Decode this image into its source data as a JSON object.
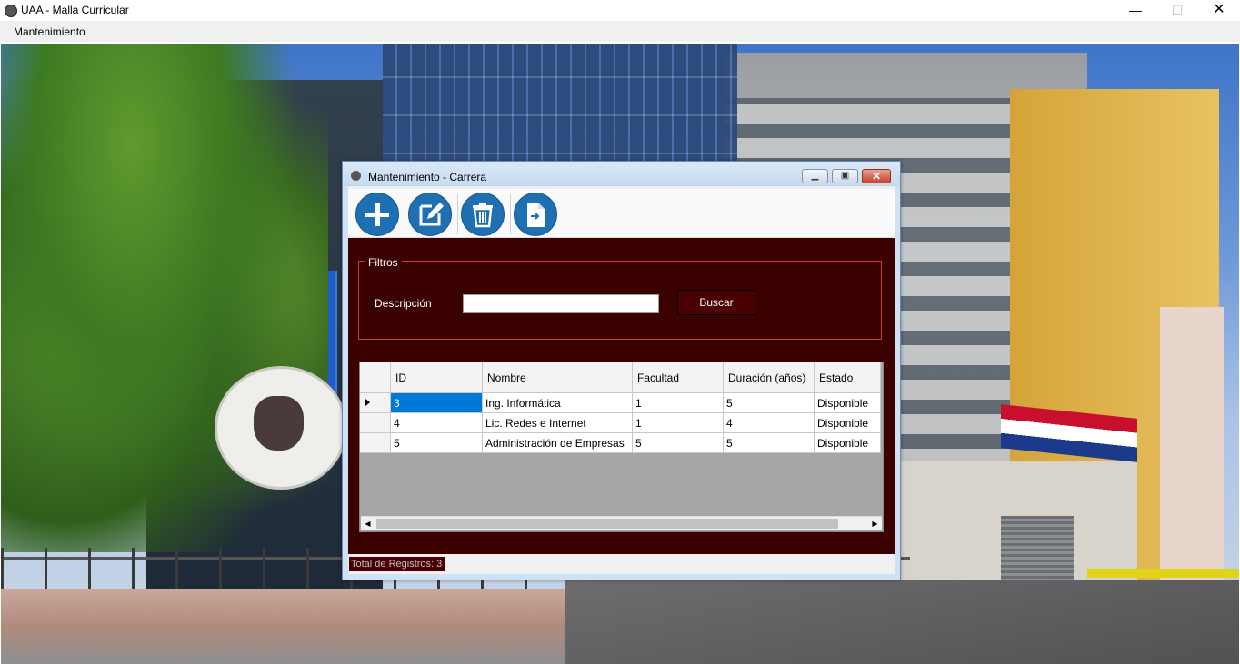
{
  "window": {
    "title": "UAA - Malla Curricular",
    "controls": {
      "minimize": "—",
      "maximize": "☐",
      "close": "✕"
    }
  },
  "menu": {
    "items": [
      {
        "label": "Mantenimiento"
      }
    ]
  },
  "dialog": {
    "title": "Mantenimiento - Carrera",
    "controls": {
      "minimize": "▁",
      "maximize": "▣",
      "close": "✕"
    },
    "toolbar": {
      "buttons": [
        {
          "name": "add",
          "icon": "plus-circle-icon"
        },
        {
          "name": "edit",
          "icon": "edit-icon"
        },
        {
          "name": "delete",
          "icon": "trash-icon"
        },
        {
          "name": "export",
          "icon": "export-file-icon"
        }
      ]
    },
    "filters": {
      "legend": "Filtros",
      "description_label": "Descripción",
      "description_value": "",
      "search_button": "Buscar"
    },
    "grid": {
      "columns": [
        "ID",
        "Nombre",
        "Facultad",
        "Duración (años)",
        "Estado"
      ],
      "rows": [
        {
          "id": "3",
          "nombre": "Ing. Informática",
          "facultad": "1",
          "duracion": "5",
          "estado": "Disponible"
        },
        {
          "id": "4",
          "nombre": "Lic. Redes e Internet",
          "facultad": "1",
          "duracion": "4",
          "estado": "Disponible"
        },
        {
          "id": "5",
          "nombre": "Administración de Empresas",
          "facultad": "5",
          "duracion": "5",
          "estado": "Disponible"
        }
      ],
      "selected_row": 0
    },
    "status": "Total de Registros: 3"
  },
  "colors": {
    "panel": "#3b0000",
    "accent_button": "#1f6fb3",
    "selection": "#0078d7",
    "filter_border": "#d13b3b"
  }
}
